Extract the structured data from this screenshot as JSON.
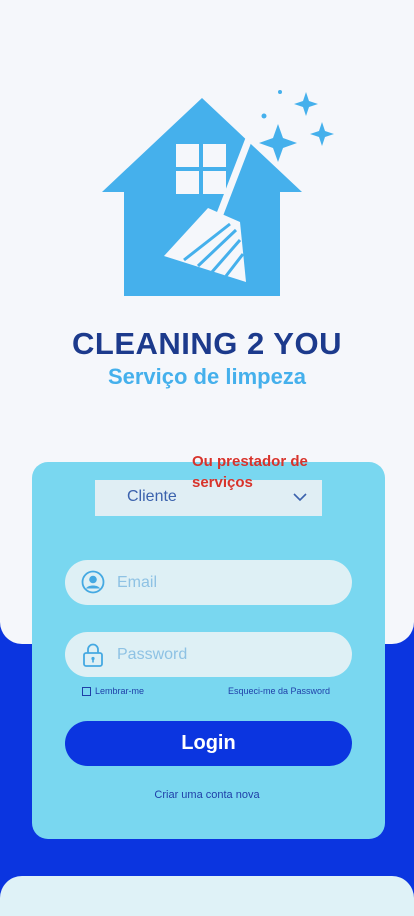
{
  "brand": {
    "title": "CLEANING 2 YOU",
    "subtitle": "Serviço de limpeza"
  },
  "note": "Ou prestador de serviços",
  "role_select": {
    "selected": "Cliente"
  },
  "email": {
    "placeholder": "Email",
    "icon": "user-circle-icon"
  },
  "password": {
    "placeholder": "Password",
    "icon": "lock-icon"
  },
  "remember_label": "Lembrar-me",
  "forgot_label": "Esqueci-me da Password",
  "login_label": "Login",
  "create_account_label": "Criar uma conta nova",
  "colors": {
    "brand_dark": "#1c3a8c",
    "brand_light": "#45b0ec",
    "card": "#79d7f0",
    "primary": "#0b35e0",
    "note": "#d8332b"
  }
}
